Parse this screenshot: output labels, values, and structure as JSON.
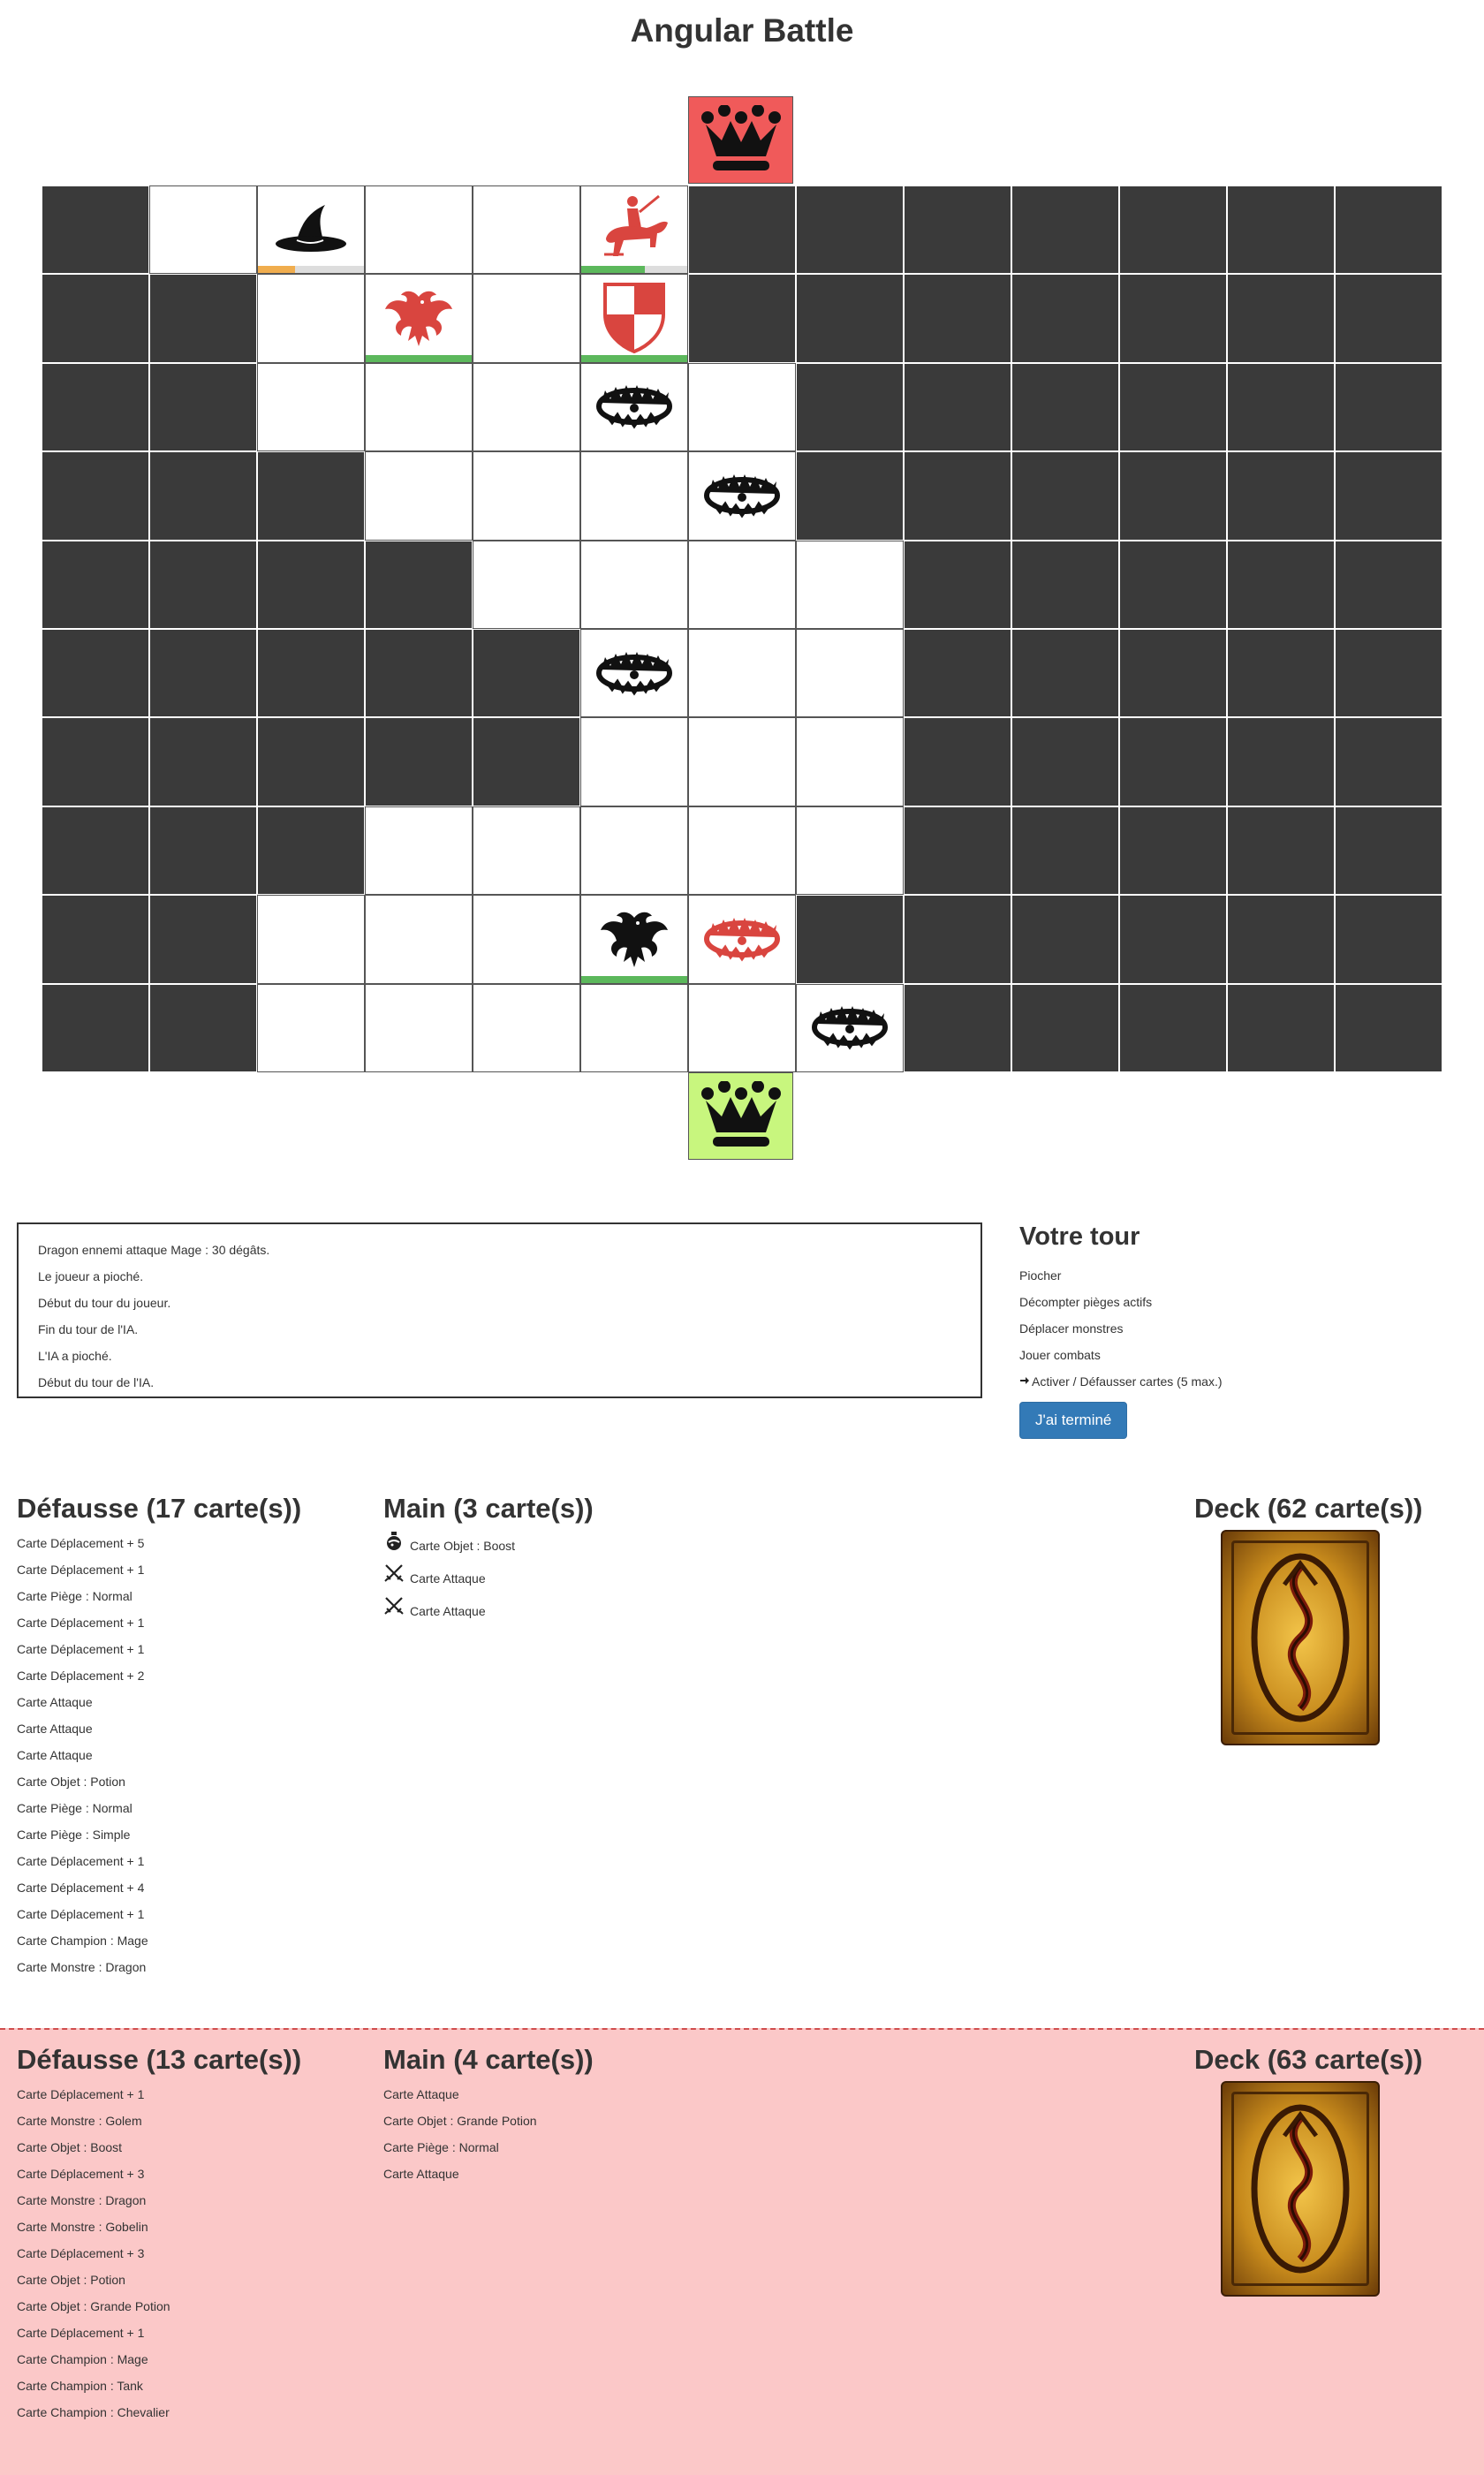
{
  "title": "Angular Battle",
  "log": [
    "Dragon ennemi attaque Mage : 30 dégâts.",
    "Le joueur a pioché.",
    "Début du tour du joueur.",
    "Fin du tour de l'IA.",
    "L'IA a pioché.",
    "Début du tour de l'IA."
  ],
  "turn": {
    "title": "Votre tour",
    "steps": [
      "Piocher",
      "Décompter pièges actifs",
      "Déplacer monstres",
      "Jouer combats"
    ],
    "active_step": "Activer / Défausser cartes (5 max.)",
    "done_label": "J'ai terminé"
  },
  "player": {
    "discard_title": "Défausse (17 carte(s))",
    "discard": [
      "Carte Déplacement + 5",
      "Carte Déplacement + 1",
      "Carte Piège : Normal",
      "Carte Déplacement + 1",
      "Carte Déplacement + 1",
      "Carte Déplacement + 2",
      "Carte Attaque",
      "Carte Attaque",
      "Carte Attaque",
      "Carte Objet : Potion",
      "Carte Piège : Normal",
      "Carte Piège : Simple",
      "Carte Déplacement + 1",
      "Carte Déplacement + 4",
      "Carte Déplacement + 1",
      "Carte Champion : Mage",
      "Carte Monstre : Dragon"
    ],
    "hand_title": "Main (3 carte(s))",
    "hand": [
      {
        "icon": "potion-icon",
        "label": "Carte Objet : Boost"
      },
      {
        "icon": "crossed-swords-icon",
        "label": "Carte Attaque"
      },
      {
        "icon": "crossed-swords-icon",
        "label": "Carte Attaque"
      }
    ],
    "deck_title": "Deck (62 carte(s))"
  },
  "enemy": {
    "discard_title": "Défausse (13 carte(s))",
    "discard": [
      "Carte Déplacement + 1",
      "Carte Monstre : Golem",
      "Carte Objet : Boost",
      "Carte Déplacement + 3",
      "Carte Monstre : Dragon",
      "Carte Monstre : Gobelin",
      "Carte Déplacement + 3",
      "Carte Objet : Potion",
      "Carte Objet : Grande Potion",
      "Carte Déplacement + 1",
      "Carte Champion : Mage",
      "Carte Champion : Tank",
      "Carte Champion : Chevalier"
    ],
    "hand_title": "Main (4 carte(s))",
    "hand": [
      "Carte Attaque",
      "Carte Objet : Grande Potion",
      "Carte Piège : Normal",
      "Carte Attaque"
    ],
    "deck_title": "Deck (63 carte(s))"
  },
  "colors": {
    "enemy_king": "#f05a5a",
    "player_king": "#c8f67e",
    "wall": "#3a3a3a",
    "enemy_piece": "#d9453f",
    "hp_green": "#5cb85c",
    "hp_orange": "#f0ad4e",
    "enemy_zone": "#fbc8c8"
  },
  "board": {
    "rows": [
      "DLLLLLDDDDDDD",
      "DDLLLLDDDDDDD",
      "DDLLLLLDDDDDD",
      "DDDLLLLDDDDDD",
      "DDDDLLLLDDDDD",
      "DDDDDLLLDDDDD",
      "DDDDDLLLDDDDD",
      "DDDLLLLLDDDDD",
      "DDLLLLLDDDDDD",
      "DDLLLLLLDDDDD"
    ],
    "pieces": [
      {
        "row": 0,
        "col": 2,
        "icon": "wizard-hat-icon",
        "color": "#111111",
        "hp": 0.35,
        "hp_color": "#f0ad4e"
      },
      {
        "row": 0,
        "col": 5,
        "icon": "knight-rider-icon",
        "color": "#d9453f",
        "hp": 0.6,
        "hp_color": "#5cb85c"
      },
      {
        "row": 1,
        "col": 3,
        "icon": "dragon-icon",
        "color": "#d9453f",
        "hp": 1,
        "hp_color": "#5cb85c"
      },
      {
        "row": 1,
        "col": 5,
        "icon": "shield-icon",
        "color": "#d9453f",
        "hp": 1,
        "hp_color": "#5cb85c"
      },
      {
        "row": 2,
        "col": 5,
        "icon": "bear-trap-icon",
        "color": "#111111"
      },
      {
        "row": 3,
        "col": 6,
        "icon": "bear-trap-icon",
        "color": "#111111"
      },
      {
        "row": 5,
        "col": 5,
        "icon": "bear-trap-icon",
        "color": "#111111"
      },
      {
        "row": 8,
        "col": 5,
        "icon": "dragon-icon",
        "color": "#111111",
        "hp": 1,
        "hp_color": "#5cb85c"
      },
      {
        "row": 8,
        "col": 6,
        "icon": "bear-trap-icon",
        "color": "#d9453f"
      },
      {
        "row": 9,
        "col": 7,
        "icon": "bear-trap-icon",
        "color": "#111111"
      }
    ]
  }
}
